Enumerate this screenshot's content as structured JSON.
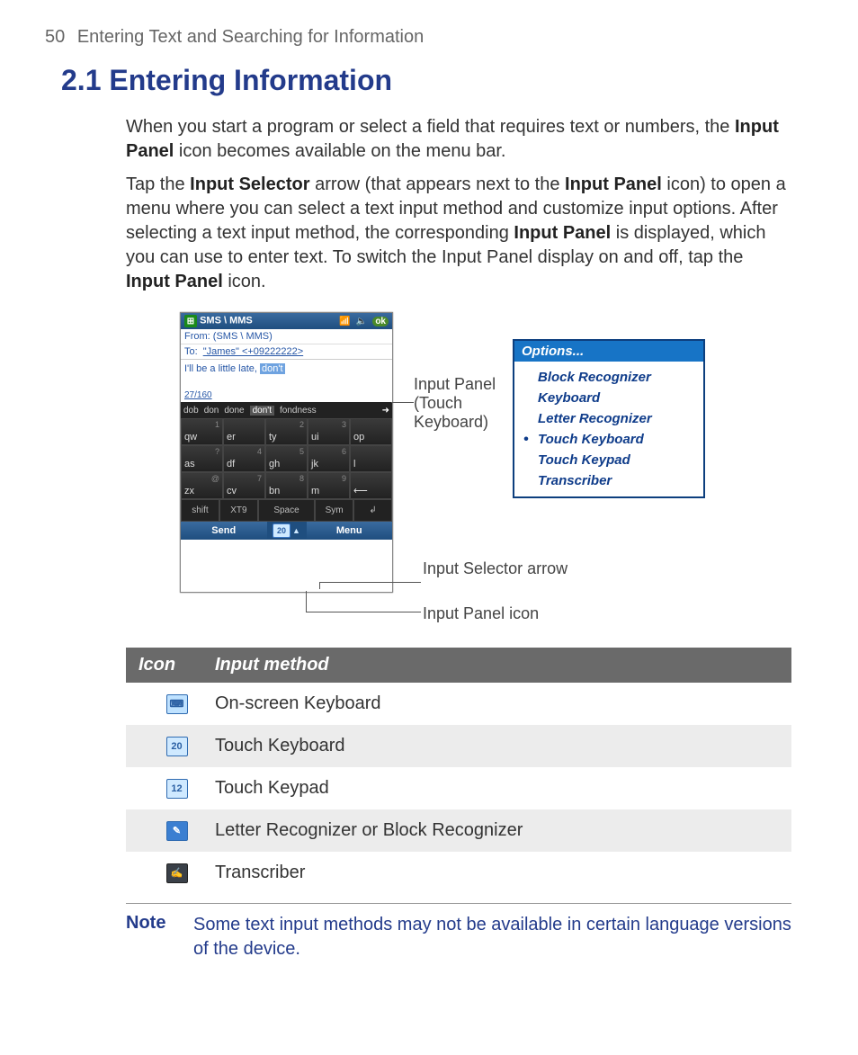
{
  "page": {
    "number": "50",
    "chapter": "Entering Text and Searching for Information"
  },
  "heading": "2.1  Entering Information",
  "para1": {
    "pre": "When you start a program or select a field that requires text or numbers, the ",
    "b1": "Input Panel",
    "post": " icon becomes available on the menu bar."
  },
  "para2": {
    "t1": "Tap the ",
    "b1": "Input Selector",
    "t2": " arrow (that appears next to the ",
    "b2": "Input Panel",
    "t3": " icon) to open a menu where you can select a text input method and customize input options. After selecting a text input method, the corresponding ",
    "b3": "Input Panel",
    "t4": " is displayed, which you can use to enter text. To switch the Input Panel display on and off, tap the ",
    "b4": "Input Panel",
    "t5": " icon."
  },
  "phone": {
    "title": "SMS \\ MMS",
    "ok": "ok",
    "from_label": "From:",
    "from_value": "(SMS \\ MMS)",
    "to_label": "To:",
    "to_value": "\"James\" <+09222222>",
    "msg_pre": "I'll be a little late, ",
    "msg_hilite": "don't",
    "count": "27/160",
    "suggest": [
      "dob",
      "don",
      "done",
      "don't",
      "fondness"
    ],
    "keys": {
      "r1": [
        {
          "k": "qw",
          "s": "1"
        },
        {
          "k": "er",
          "s": ""
        },
        {
          "k": "ty",
          "s": "2"
        },
        {
          "k": "ui",
          "s": "3"
        },
        {
          "k": "op",
          "s": ""
        }
      ],
      "r2": [
        {
          "k": "as",
          "s": "?"
        },
        {
          "k": "df",
          "s": "4"
        },
        {
          "k": "gh",
          "s": "5"
        },
        {
          "k": "jk",
          "s": "6"
        },
        {
          "k": "l",
          "s": ""
        }
      ],
      "r3": [
        {
          "k": "zx",
          "s": "@"
        },
        {
          "k": "cv",
          "s": "7"
        },
        {
          "k": "bn",
          "s": "8"
        },
        {
          "k": "m",
          "s": "9"
        },
        {
          "k": "⟵",
          "s": ""
        }
      ],
      "r4": [
        "shift",
        "XT9",
        "Space",
        "Sym",
        "↲"
      ]
    },
    "menu_left": "Send",
    "menu_right": "Menu",
    "menu_icon": "20"
  },
  "callouts": {
    "input_panel": "Input Panel (Touch Keyboard)",
    "selector_arrow": "Input Selector arrow",
    "panel_icon": "Input Panel icon"
  },
  "options": {
    "header": "Options...",
    "items": [
      "Block Recognizer",
      "Keyboard",
      "Letter Recognizer",
      "Touch Keyboard",
      "Touch Keypad",
      "Transcriber"
    ],
    "selected_index": 3
  },
  "table": {
    "h1": "Icon",
    "h2": "Input method",
    "rows": [
      {
        "icon": "kbd",
        "label": "On-screen Keyboard"
      },
      {
        "icon": "20",
        "label": "Touch Keyboard"
      },
      {
        "icon": "12",
        "label": "Touch Keypad"
      },
      {
        "icon": "pen",
        "label": "Letter Recognizer or Block Recognizer"
      },
      {
        "icon": "tr",
        "label": "Transcriber"
      }
    ]
  },
  "note": {
    "label": "Note",
    "text": "Some text input methods may not be available in certain language versions of the device."
  }
}
